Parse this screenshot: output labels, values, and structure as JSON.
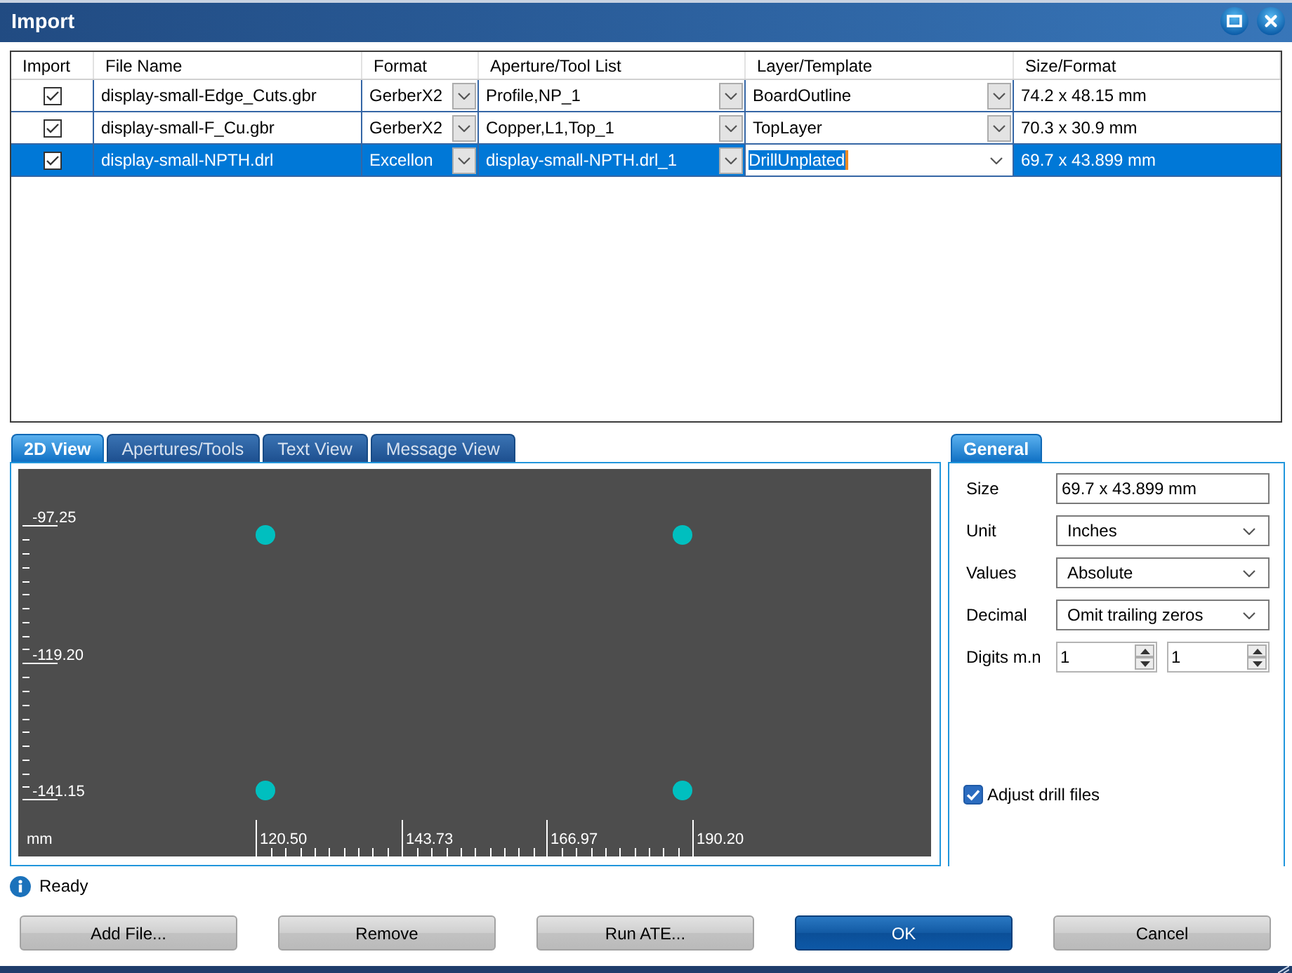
{
  "window": {
    "title": "Import"
  },
  "table": {
    "columns": [
      "Import",
      "File Name",
      "Format",
      "Aperture/Tool List",
      "Layer/Template",
      "Size/Format"
    ],
    "rows": [
      {
        "import": true,
        "file_name": "display-small-Edge_Cuts.gbr",
        "format": "GerberX2",
        "aperture_tool_list": "Profile,NP_1",
        "layer_template": "BoardOutline",
        "layer_editing": false,
        "size_format": "74.2 x 48.15 mm",
        "selected": false
      },
      {
        "import": true,
        "file_name": "display-small-F_Cu.gbr",
        "format": "GerberX2",
        "aperture_tool_list": "Copper,L1,Top_1",
        "layer_template": "TopLayer",
        "layer_editing": false,
        "size_format": "70.3 x 30.9 mm",
        "selected": false
      },
      {
        "import": true,
        "file_name": "display-small-NPTH.drl",
        "format": "Excellon",
        "aperture_tool_list": "display-small-NPTH.drl_1",
        "layer_template": "DrillUnplated",
        "layer_editing": true,
        "size_format": "69.7 x 43.899 mm",
        "selected": true
      }
    ]
  },
  "view_tabs": [
    {
      "label": "2D View",
      "selected": true
    },
    {
      "label": "Apertures/Tools",
      "selected": false
    },
    {
      "label": "Text View",
      "selected": false
    },
    {
      "label": "Message View",
      "selected": false
    }
  ],
  "view_2d": {
    "unit": "mm",
    "x_ruler_labels": [
      "120.50",
      "143.73",
      "166.97",
      "190.20"
    ],
    "y_ruler_labels": [
      "-97.25",
      "-119.20",
      "-141.15"
    ]
  },
  "general_panel": {
    "tab": {
      "label": "General",
      "selected": true
    },
    "fields": [
      {
        "kind": "text",
        "label": "Size",
        "value": "69.7 x 43.899 mm"
      },
      {
        "kind": "dropdown",
        "label": "Unit",
        "value": "Inches"
      },
      {
        "kind": "dropdown",
        "label": "Values",
        "value": "Absolute"
      },
      {
        "kind": "dropdown",
        "label": "Decimal",
        "value": "Omit trailing zeros"
      },
      {
        "kind": "spin_pair",
        "label": "Digits m.n",
        "values": [
          "1",
          "1"
        ]
      }
    ],
    "adjust_drill_files": {
      "label": "Adjust drill files",
      "checked": true
    }
  },
  "status_bar": {
    "text": "Ready"
  },
  "buttons": [
    {
      "label": "Add File...",
      "primary": false
    },
    {
      "label": "Remove",
      "primary": false
    },
    {
      "label": "Run ATE...",
      "primary": false
    },
    {
      "label": "OK",
      "primary": true
    },
    {
      "label": "Cancel",
      "primary": false
    }
  ]
}
